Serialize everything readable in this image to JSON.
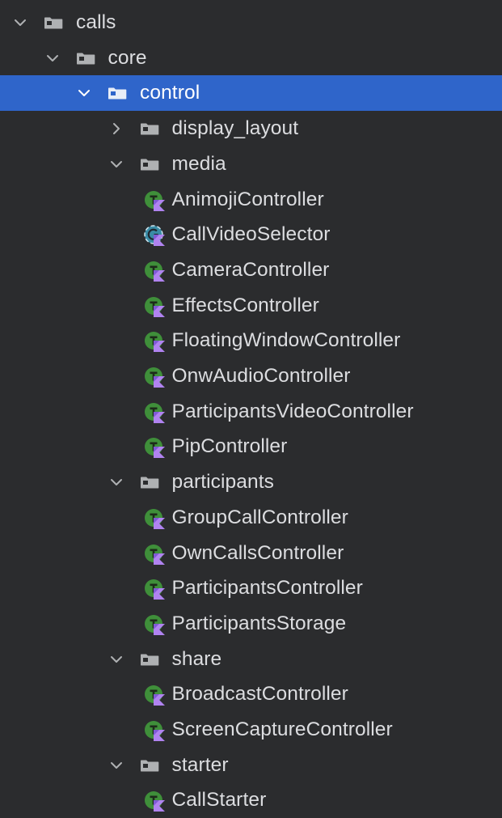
{
  "project_tree": {
    "nodes": [
      {
        "label": "calls",
        "kind": "folder",
        "depth": 0,
        "expanded": true
      },
      {
        "label": "core",
        "kind": "folder",
        "depth": 1,
        "expanded": true
      },
      {
        "label": "control",
        "kind": "folder",
        "depth": 2,
        "expanded": true,
        "selected": true
      },
      {
        "label": "display_layout",
        "kind": "folder",
        "depth": 3,
        "expanded": false
      },
      {
        "label": "media",
        "kind": "folder",
        "depth": 3,
        "expanded": true
      },
      {
        "label": "AnimojiController",
        "kind": "kotlin-class",
        "depth": 4
      },
      {
        "label": "CallVideoSelector",
        "kind": "kotlin-class-variant",
        "depth": 4
      },
      {
        "label": "CameraController",
        "kind": "kotlin-class",
        "depth": 4
      },
      {
        "label": "EffectsController",
        "kind": "kotlin-class",
        "depth": 4
      },
      {
        "label": "FloatingWindowController",
        "kind": "kotlin-class",
        "depth": 4
      },
      {
        "label": "OnwAudioController",
        "kind": "kotlin-class",
        "depth": 4
      },
      {
        "label": "ParticipantsVideoController",
        "kind": "kotlin-class",
        "depth": 4
      },
      {
        "label": "PipController",
        "kind": "kotlin-class",
        "depth": 4
      },
      {
        "label": "participants",
        "kind": "folder",
        "depth": 3,
        "expanded": true
      },
      {
        "label": "GroupCallController",
        "kind": "kotlin-class",
        "depth": 4
      },
      {
        "label": "OwnCallsController",
        "kind": "kotlin-class",
        "depth": 4
      },
      {
        "label": "ParticipantsController",
        "kind": "kotlin-class",
        "depth": 4
      },
      {
        "label": "ParticipantsStorage",
        "kind": "kotlin-class",
        "depth": 4
      },
      {
        "label": "share",
        "kind": "folder",
        "depth": 3,
        "expanded": true
      },
      {
        "label": "BroadcastController",
        "kind": "kotlin-class",
        "depth": 4
      },
      {
        "label": "ScreenCaptureController",
        "kind": "kotlin-class",
        "depth": 4
      },
      {
        "label": "starter",
        "kind": "folder",
        "depth": 3,
        "expanded": true
      },
      {
        "label": "CallStarter",
        "kind": "kotlin-class",
        "depth": 4
      }
    ]
  },
  "colors": {
    "background": "#2b2c2e",
    "selection": "#2f65ca",
    "text": "#dcdde0",
    "folder": "#afb1b3",
    "class_badge": "#3f8f3a",
    "variant_badge": "#3a8ca6",
    "kotlin_mark": "#b083f0"
  }
}
